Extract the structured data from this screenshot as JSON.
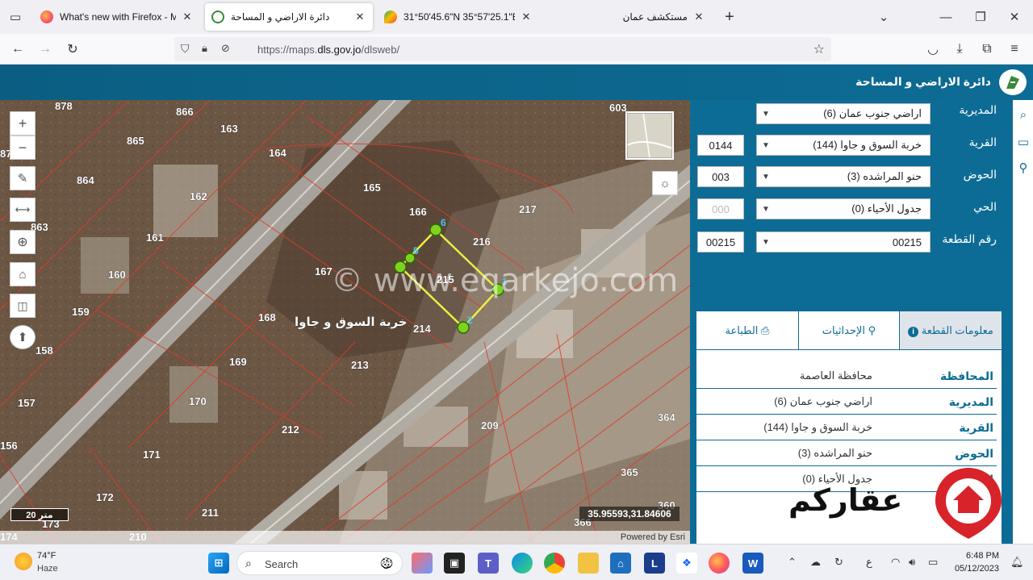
{
  "browser": {
    "tabs": [
      {
        "label": "What's new with Firefox - More",
        "active": false
      },
      {
        "label": "دائرة الاراضي و المساحة",
        "active": true
      },
      {
        "label": "31°50'45.6\"N 35°57'25.1\"E خرائط",
        "active": false
      },
      {
        "label": "مستكشف عمان",
        "active": false
      }
    ],
    "url_prefix": "https://maps.",
    "url_domain": "dls.gov.jo",
    "url_path": "/dlsweb/"
  },
  "app": {
    "title": "دائرة الاراضي و المساحة"
  },
  "map": {
    "scale": "20 متر",
    "coordinates": "35.95593,31.84606",
    "attribution": "Powered by Esri",
    "watermark": "© www.eqarkejo.com",
    "area_label": "خربة السوق و جاوا",
    "parcels": [
      "878",
      "866",
      "163",
      "865",
      "164",
      "87",
      "864",
      "162",
      "165",
      "166",
      "217",
      "863",
      "161",
      "216",
      "167",
      "215",
      "160",
      "159",
      "168",
      "214",
      "158",
      "169",
      "213",
      "170",
      "157",
      "212",
      "209",
      "364",
      "156",
      "171",
      "365",
      "172",
      "211",
      "360",
      "173",
      "366",
      "174",
      "210",
      "603"
    ],
    "vertices": [
      "6",
      "5",
      "1",
      "2"
    ]
  },
  "form": {
    "directorate_label": "المديرية",
    "directorate_value": "اراضي جنوب عمان (6)",
    "village_label": "القرية",
    "village_value": "خربة السوق و جاوا (144)",
    "village_code": "0144",
    "basin_label": "الحوض",
    "basin_value": "حنو المراشده (3)",
    "basin_code": "003",
    "district_label": "الحي",
    "district_value": "جدول الأحياء (0)",
    "district_code": "000",
    "parcel_label": "رقم القطعة",
    "parcel_value": "00215",
    "parcel_code": "00215"
  },
  "info_tabs": {
    "info": "معلومات القطعة",
    "coords": "الإحداثيات",
    "print": "الطباعة"
  },
  "info_rows": [
    {
      "key": "المحافظة",
      "value": "محافظة العاصمة"
    },
    {
      "key": "المديرية",
      "value": "اراضي جنوب عمان (6)"
    },
    {
      "key": "القرية",
      "value": "خربة السوق و جاوا (144)"
    },
    {
      "key": "الحوض",
      "value": "حنو المراشده (3)"
    },
    {
      "key": "الحي",
      "value": "جدول الأحياء (0)"
    }
  ],
  "watermark_brand": "عقاركم",
  "taskbar": {
    "temperature": "74°F",
    "weather": "Haze",
    "search_placeholder": "Search",
    "time": "6:48 PM",
    "date": "05/12/2023",
    "lang": "ع"
  }
}
